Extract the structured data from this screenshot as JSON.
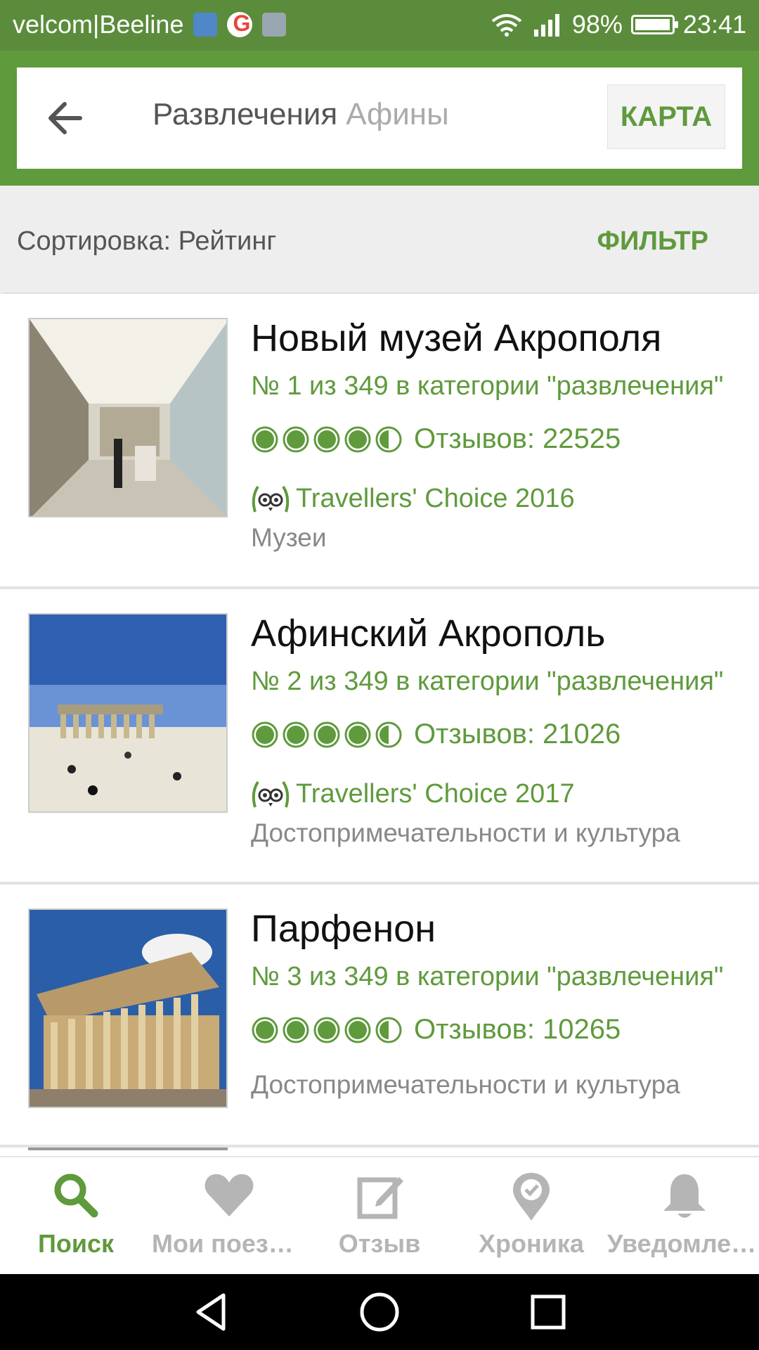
{
  "status_bar": {
    "carrier": "velcom|Beeline",
    "battery": "98%",
    "time": "23:41"
  },
  "header": {
    "search_query": "Развлечения",
    "search_location": "Афины",
    "map_button": "КАРТА"
  },
  "sort_bar": {
    "sort_label": "Сортировка: Рейтинг",
    "filter_button": "ФИЛЬТР"
  },
  "listings": [
    {
      "title": "Новый музей Акрополя",
      "rank": "№ 1 из 349 в категории \"развлечения\"",
      "rating": 4.5,
      "reviews": "Отзывов: 22525",
      "award": "Travellers' Choice 2016",
      "category": "Музеи"
    },
    {
      "title": "Афинский Акрополь",
      "rank": "№ 2 из 349 в категории \"развлечения\"",
      "rating": 4.5,
      "reviews": "Отзывов: 21026",
      "award": "Travellers' Choice 2017",
      "category": "Достопримечательности и культура"
    },
    {
      "title": "Парфенон",
      "rank": "№ 3 из 349 в категории \"развлечения\"",
      "rating": 4.5,
      "reviews": "Отзывов: 10265",
      "category": "Достопримечательности и культура"
    }
  ],
  "bottom_nav": [
    {
      "label": "Поиск",
      "icon": "search-icon",
      "active": true
    },
    {
      "label": "Мои поездки",
      "icon": "heart-icon",
      "active": false
    },
    {
      "label": "Отзыв",
      "icon": "edit-icon",
      "active": false
    },
    {
      "label": "Хроника",
      "icon": "location-check-icon",
      "active": false
    },
    {
      "label": "Уведомления",
      "icon": "bell-icon",
      "active": false
    }
  ],
  "colors": {
    "brand_green": "#5f9a3c",
    "status_bar": "#5b8c3c"
  }
}
